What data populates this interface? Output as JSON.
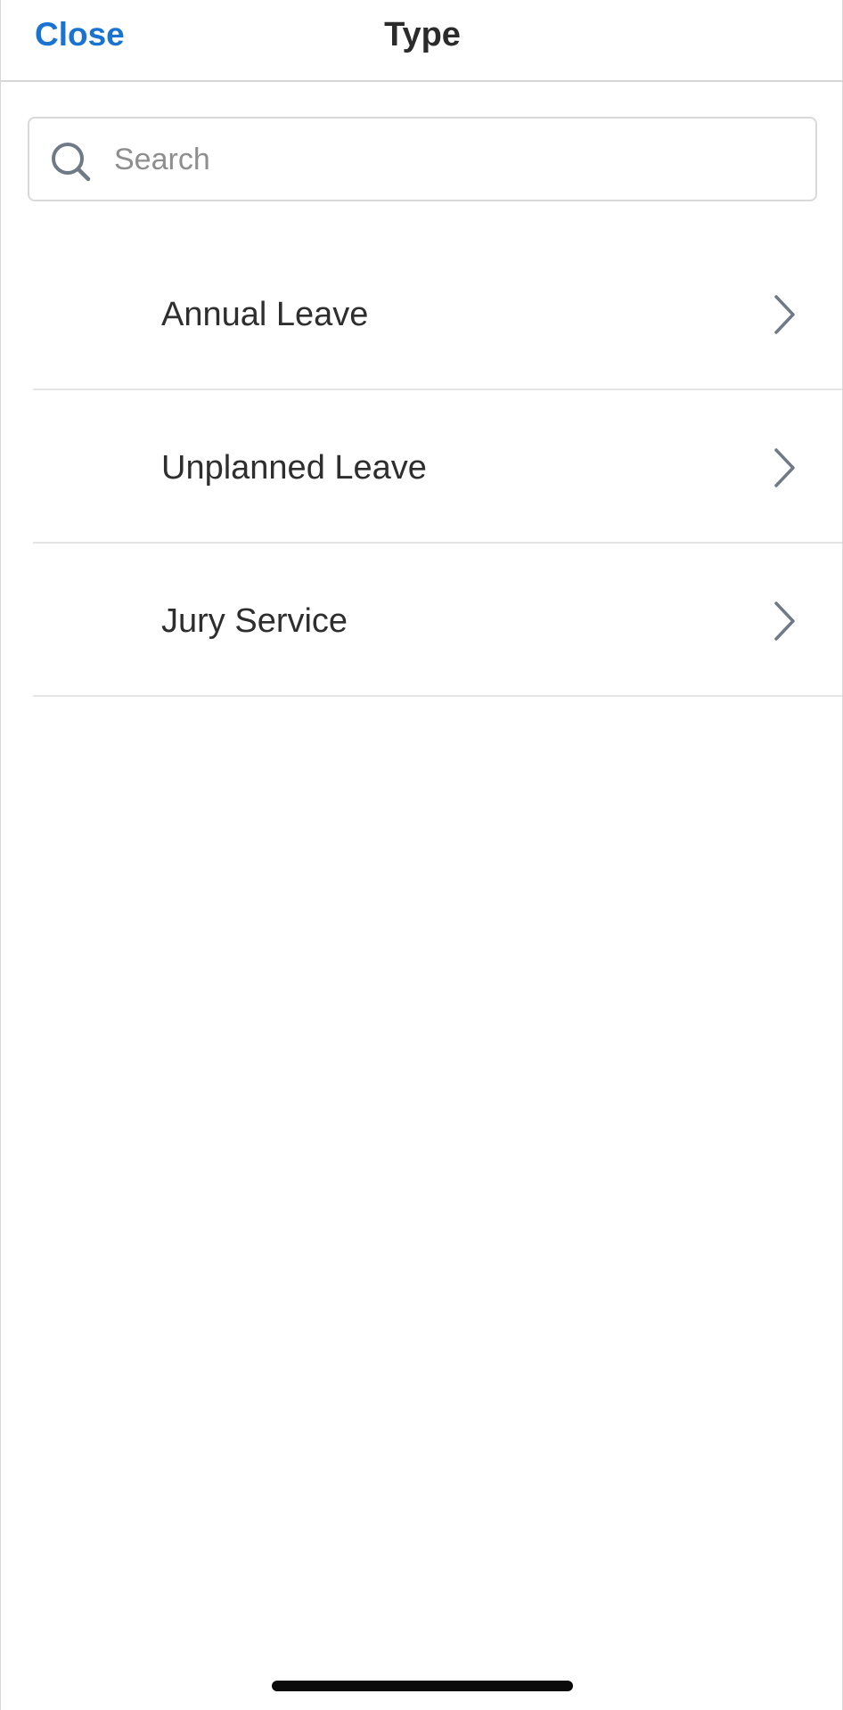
{
  "header": {
    "close_label": "Close",
    "title": "Type"
  },
  "search": {
    "placeholder": "Search",
    "value": "",
    "icon": "search-icon"
  },
  "list": {
    "items": [
      {
        "label": "Annual Leave",
        "icon": "chevron-right-icon"
      },
      {
        "label": "Unplanned Leave",
        "icon": "chevron-right-icon"
      },
      {
        "label": "Jury Service",
        "icon": "chevron-right-icon"
      }
    ]
  },
  "colors": {
    "accent": "#1a73d0",
    "title_text": "#2b2b2b",
    "placeholder": "#8e8e8e",
    "icon_gray": "#6f7a86",
    "divider": "#e4e4e4"
  }
}
